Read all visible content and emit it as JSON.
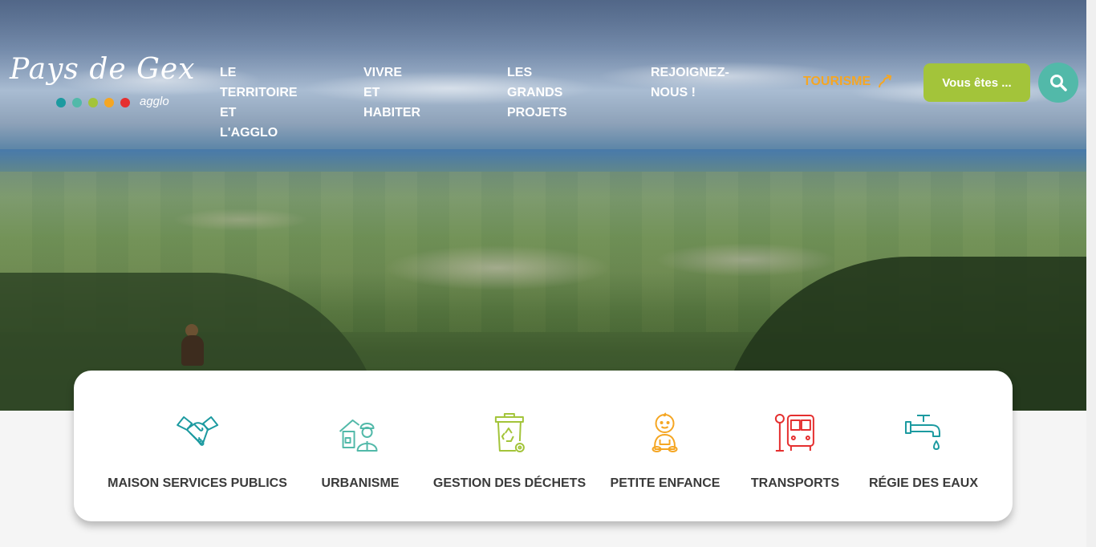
{
  "header": {
    "logo": {
      "text": "Pays de Gex",
      "sub": "agglo",
      "dot_colors": [
        "#1c9aa0",
        "#52b9a9",
        "#a3c43a",
        "#f5a623",
        "#e52f2f"
      ]
    },
    "nav": [
      {
        "label": "LE TERRITOIRE\nET L'AGGLO"
      },
      {
        "label": "VIVRE ET\nHABITER"
      },
      {
        "label": "LES GRANDS\nPROJETS"
      },
      {
        "label": "REJOIGNEZ-\nNOUS !"
      }
    ],
    "tourisme": {
      "label": "TOURISME",
      "icon": "external-route-icon",
      "color": "#f5a623"
    },
    "vous_etes": {
      "label": "Vous êtes ...",
      "color": "#a3c43a"
    },
    "search": {
      "icon": "search-icon",
      "color": "#52b9a9"
    }
  },
  "services": [
    {
      "label": "MAISON SERVICES PUBLICS",
      "icon": "handshake-icon",
      "color": "#1c9aa0"
    },
    {
      "label": "URBANISME",
      "icon": "builder-house-icon",
      "color": "#52b9a9"
    },
    {
      "label": "GESTION DES DÉCHETS",
      "icon": "recycling-bin-icon",
      "color": "#a3c43a"
    },
    {
      "label": "PETITE ENFANCE",
      "icon": "baby-icon",
      "color": "#f5a623"
    },
    {
      "label": "TRANSPORTS",
      "icon": "bus-stop-icon",
      "color": "#e52f2f"
    },
    {
      "label": "RÉGIE DES EAUX",
      "icon": "water-tap-icon",
      "color": "#1c9aa0"
    }
  ]
}
